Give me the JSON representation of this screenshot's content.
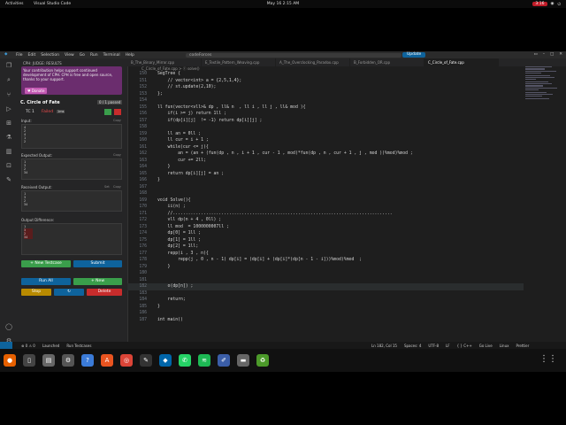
{
  "gnome": {
    "activities": "Activities",
    "app": "Visual Studio Code",
    "clock": "May 16  2:15 AM",
    "rec": "3:16"
  },
  "menu": [
    "File",
    "Edit",
    "Selection",
    "View",
    "Go",
    "Run",
    "Terminal",
    "Help"
  ],
  "search": {
    "placeholder": "codeForces"
  },
  "update_label": "Update",
  "sidebar": {
    "title": "CPH: JUDGE: RESULTS",
    "promo": "Your contribution helps support continued development of CPH. CPH is free and open source, thanks to your support.",
    "donate": "Donate",
    "problem": "C. Circle of Fate",
    "passed": "0 / 1 passed",
    "tc_label": "TC 1",
    "tc_result": "Failed",
    "tc_time": "1ms",
    "input_label": "Input:",
    "input": [
      "4",
      "2",
      "4",
      "1",
      "2"
    ],
    "expected_label": "Expected Output:",
    "expected": [
      "1",
      "3",
      "2",
      "34"
    ],
    "received_label": "Received Output:",
    "received": [
      "1",
      "3",
      "2",
      "34"
    ],
    "diff_label": "Output Difference:",
    "diff": [
      "1",
      "3",
      "2",
      "34"
    ],
    "copy": "Copy",
    "set": "Set",
    "new_testcase": "+ New Testcase",
    "submit": "Submit",
    "run_all": "Run All",
    "new": "+ New",
    "stop": "Stop",
    "delete": "Delete"
  },
  "tabs": [
    "B_The_Binary_Mirror.cpp",
    "E_Textile_Pattern_Weaving.cpp",
    "A_The_Overclocking_Paradox.cpp",
    "B_Forbidden_OR.cpp",
    "C_Circle_of_Fate.cpp"
  ],
  "breadcrumb": "C_Circle_of_Fate.cpp > ⓕ solve()",
  "code": [
    {
      "n": "150",
      "t": "SegTree {"
    },
    {
      "n": "151",
      "t": "    // vector<int> a = {2,5,1,4};"
    },
    {
      "n": "152",
      "t": "    // st.update(2,10);"
    },
    {
      "n": "153",
      "t": "};"
    },
    {
      "n": "154",
      "t": ""
    },
    {
      "n": "155",
      "t": "ll fun(vector<vll>& dp , ll& n  , ll i , ll j , ll& mod ){"
    },
    {
      "n": "156",
      "t": "    if(i >= j) return 1ll ;"
    },
    {
      "n": "157",
      "t": "    if(dp[i][j]  != -1) return dp[i][j] ;"
    },
    {
      "n": "158",
      "t": ""
    },
    {
      "n": "159",
      "t": "    ll an = 0ll ;"
    },
    {
      "n": "160",
      "t": "    ll cur = i + 1 ;"
    },
    {
      "n": "161",
      "t": "    while(cur <= j){"
    },
    {
      "n": "162",
      "t": "        an = (an + (fun(dp , n , i + 1 , cur - 1 , mod)*fun(dp , n , cur + 1 , j , mod ))%mod)%mod ;"
    },
    {
      "n": "163",
      "t": "        cur += 2ll;"
    },
    {
      "n": "164",
      "t": "    }"
    },
    {
      "n": "165",
      "t": "    return dp[i][j] = an ;"
    },
    {
      "n": "166",
      "t": "}"
    },
    {
      "n": "167",
      "t": ""
    },
    {
      "n": "168",
      "t": ""
    },
    {
      "n": "169",
      "t": "void Solve(){"
    },
    {
      "n": "170",
      "t": "    ii(n) ;"
    },
    {
      "n": "171",
      "t": "    //......................................................................................"
    },
    {
      "n": "172",
      "t": "    vll dp(n + 4 , 0ll) ;"
    },
    {
      "n": "173",
      "t": "    ll mod  = 1000000007ll ;"
    },
    {
      "n": "174",
      "t": "    dp[0] = 1ll ;"
    },
    {
      "n": "175",
      "t": "    dp[1] = 1ll ;"
    },
    {
      "n": "176",
      "t": "    dp[2] = 1ll;"
    },
    {
      "n": "177",
      "t": "    repp(i , 3 , n){"
    },
    {
      "n": "178",
      "t": "        repp(j , 0 , n - 1) dp[i] = (dp[i] + (dp[i]*(dp[n - 1 - i]))%mod)%mod  ;"
    },
    {
      "n": "179",
      "t": "    }"
    },
    {
      "n": "180",
      "t": ""
    },
    {
      "n": "181",
      "t": ""
    },
    {
      "n": "182",
      "t": "    o(dp[n]) ;"
    },
    {
      "n": "183",
      "t": ""
    },
    {
      "n": "184",
      "t": "    return;"
    },
    {
      "n": "185",
      "t": "}"
    },
    {
      "n": "186",
      "t": ""
    },
    {
      "n": "187",
      "t": "int main()"
    }
  ],
  "status": {
    "left": [
      "⊗ 0 ⚠ 0",
      "Launched",
      "Run Testcases"
    ],
    "right": [
      "Ln 182, Col 15",
      "Spaces: 4",
      "UTF-8",
      "LF",
      "{ } C++",
      "Go Live",
      "Linux",
      "Prettier"
    ]
  }
}
